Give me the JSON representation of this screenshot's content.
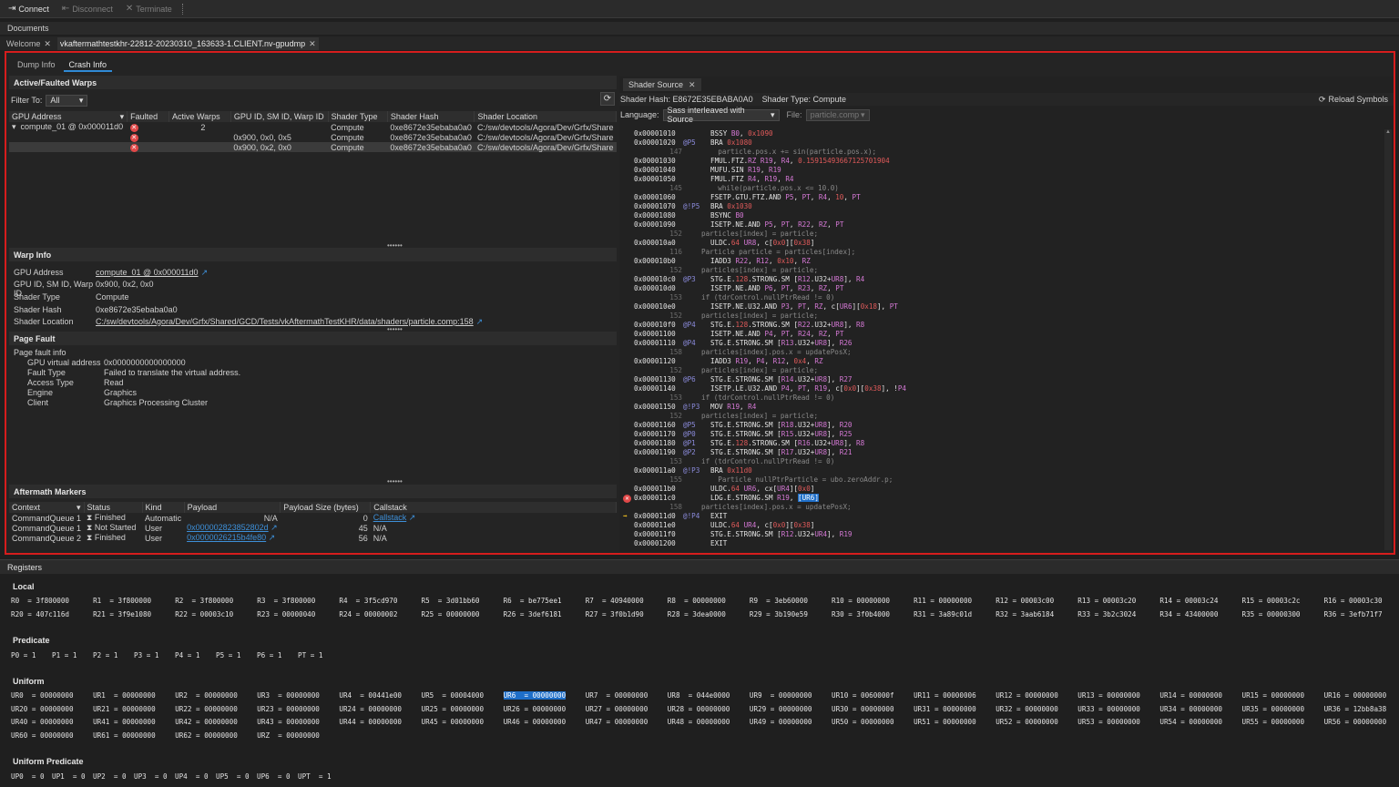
{
  "toolbar": {
    "connect": "Connect",
    "disconnect": "Disconnect",
    "terminate": "Terminate"
  },
  "documents_label": "Documents",
  "doc_tabs": [
    {
      "label": "Welcome"
    },
    {
      "label": "vkaftermathtestkhr-22812-20230310_163633-1.CLIENT.nv-gpudmp"
    }
  ],
  "sub_tabs": [
    "Dump Info",
    "Crash Info"
  ],
  "warps": {
    "title": "Active/Faulted Warps",
    "filter_label": "Filter To:",
    "filter_value": "All",
    "columns": [
      "GPU Address",
      "Faulted",
      "Active Warps",
      "GPU ID, SM ID, Warp ID",
      "Shader Type",
      "Shader Hash",
      "Shader Location"
    ],
    "rows": [
      {
        "addr": "compute_01 @ 0x000011d0",
        "faulted": true,
        "active": "2",
        "ids": "",
        "type": "Compute",
        "hash": "0xe8672e35ebaba0a0",
        "loc": "C:/sw/devtools/Agora/Dev/Grfx/Share"
      },
      {
        "addr": "",
        "faulted": true,
        "active": "",
        "ids": "0x900, 0x0, 0x5",
        "type": "Compute",
        "hash": "0xe8672e35ebaba0a0",
        "loc": "C:/sw/devtools/Agora/Dev/Grfx/Share"
      },
      {
        "addr": "",
        "faulted": true,
        "active": "",
        "ids": "0x900, 0x2, 0x0",
        "type": "Compute",
        "hash": "0xe8672e35ebaba0a0",
        "loc": "C:/sw/devtools/Agora/Dev/Grfx/Share"
      }
    ]
  },
  "warp_info": {
    "title": "Warp Info",
    "rows": [
      {
        "k": "GPU Address",
        "v": "compute_01 @ 0x000011d0"
      },
      {
        "k": "GPU ID, SM ID, Warp ID",
        "v": "0x900, 0x2, 0x0"
      },
      {
        "k": "Shader Type",
        "v": "Compute"
      },
      {
        "k": "Shader Hash",
        "v": "0xe8672e35ebaba0a0"
      },
      {
        "k": "Shader Location",
        "v": "C:/sw/devtools/Agora/Dev/Grfx/Shared/GCD/Tests/vkAftermathTestKHR/data/shaders/particle.comp:158"
      }
    ]
  },
  "page_fault": {
    "title": "Page Fault",
    "info_label": "Page fault info",
    "rows": [
      {
        "k": "GPU virtual address",
        "v": "0x0000000000000000"
      },
      {
        "k": "Fault Type",
        "v": "Failed to translate the virtual address."
      },
      {
        "k": "Access Type",
        "v": "Read"
      },
      {
        "k": "Engine",
        "v": "Graphics"
      },
      {
        "k": "Client",
        "v": "Graphics Processing Cluster"
      }
    ]
  },
  "markers": {
    "title": "Aftermath Markers",
    "columns": [
      "Context",
      "Status",
      "Kind",
      "Payload",
      "Payload Size (bytes)",
      "Callstack"
    ],
    "rows": [
      {
        "ctx": "CommandQueue 1",
        "status": "Finished",
        "kind": "Automatic",
        "payload": "N/A",
        "size": "0",
        "callstack": "Callstack"
      },
      {
        "ctx": "CommandQueue 1",
        "status": "Not Started",
        "kind": "User",
        "payload": "0x000002823852802d",
        "size": "45",
        "callstack": "N/A"
      },
      {
        "ctx": "CommandQueue 2",
        "status": "Finished",
        "kind": "User",
        "payload": "0x0000026215b4fe80",
        "size": "56",
        "callstack": "N/A"
      }
    ]
  },
  "shader": {
    "tab": "Shader Source",
    "hash": "Shader Hash: E8672E35EBABA0A0",
    "type": "Shader Type: Compute",
    "reload": "Reload Symbols",
    "language_label": "Language:",
    "language_value": "Sass interleaved with Source",
    "file_label": "File:",
    "file_value": "particle.comp",
    "lines": [
      {
        "a": "0x00001010",
        "p": "",
        "i": "BSSY B0, 0x1090"
      },
      {
        "a": "0x00001020",
        "p": "@P5",
        "i": "BRA 0x1080"
      },
      {
        "n": "147",
        "s": "    particle.pos.x += sin(particle.pos.x);"
      },
      {
        "a": "0x00001030",
        "p": "",
        "i": "FMUL.FTZ.RZ R19, R4, 0.15915493667125701904"
      },
      {
        "a": "0x00001040",
        "p": "",
        "i": "MUFU.SIN R19, R19"
      },
      {
        "a": "0x00001050",
        "p": "",
        "i": "FMUL.FTZ R4, R19, R4"
      },
      {
        "n": "145",
        "s": "    while(particle.pos.x <= 10.0)"
      },
      {
        "a": "0x00001060",
        "p": "",
        "i": "FSETP.GTU.FTZ.AND P5, PT, R4, 10, PT"
      },
      {
        "a": "0x00001070",
        "p": "@!P5",
        "i": "BRA 0x1030"
      },
      {
        "a": "0x00001080",
        "p": "",
        "i": "BSYNC B0"
      },
      {
        "a": "0x00001090",
        "p": "",
        "i": "ISETP.NE.AND P5, PT, R22, RZ, PT"
      },
      {
        "n": "152",
        "s": "particles[index] = particle;"
      },
      {
        "a": "0x000010a0",
        "p": "",
        "i": "ULDC.64 UR8, c[0x0][0x38]"
      },
      {
        "n": "116",
        "s": "Particle particle = particles[index];"
      },
      {
        "a": "0x000010b0",
        "p": "",
        "i": "IADD3 R22, R12, 0x10, RZ"
      },
      {
        "n": "152",
        "s": "particles[index] = particle;"
      },
      {
        "a": "0x000010c0",
        "p": "@P3",
        "i": "STG.E.128.STRONG.SM [R12.U32+UR8], R4"
      },
      {
        "a": "0x000010d0",
        "p": "",
        "i": "ISETP.NE.AND P6, PT, R23, RZ, PT"
      },
      {
        "n": "153",
        "s": "if (tdrControl.nullPtrRead != 0)"
      },
      {
        "a": "0x000010e0",
        "p": "",
        "i": "ISETP.NE.U32.AND P3, PT, RZ, c[UR6][0x18], PT"
      },
      {
        "n": "152",
        "s": "particles[index] = particle;"
      },
      {
        "a": "0x000010f0",
        "p": "@P4",
        "i": "STG.E.128.STRONG.SM [R22.U32+UR8], R8"
      },
      {
        "a": "0x00001100",
        "p": "",
        "i": "ISETP.NE.AND P4, PT, R24, RZ, PT"
      },
      {
        "a": "0x00001110",
        "p": "@P4",
        "i": "STG.E.STRONG.SM [R13.U32+UR8], R26"
      },
      {
        "n": "158",
        "s": "particles[index].pos.x = updatePosX;"
      },
      {
        "a": "0x00001120",
        "p": "",
        "i": "IADD3 R19, P4, R12, 0x4, RZ"
      },
      {
        "n": "152",
        "s": "particles[index] = particle;"
      },
      {
        "a": "0x00001130",
        "p": "@P6",
        "i": "STG.E.STRONG.SM [R14.U32+UR8], R27"
      },
      {
        "a": "0x00001140",
        "p": "",
        "i": "ISETP.LE.U32.AND P4, PT, R19, c[0x0][0x38], !P4"
      },
      {
        "n": "153",
        "s": "if (tdrControl.nullPtrRead != 0)"
      },
      {
        "a": "0x00001150",
        "p": "@!P3",
        "i": "MOV R19, R4"
      },
      {
        "n": "152",
        "s": "particles[index] = particle;"
      },
      {
        "a": "0x00001160",
        "p": "@P5",
        "i": "STG.E.STRONG.SM [R18.U32+UR8], R20"
      },
      {
        "a": "0x00001170",
        "p": "@P0",
        "i": "STG.E.STRONG.SM [R15.U32+UR8], R25"
      },
      {
        "a": "0x00001180",
        "p": "@P1",
        "i": "STG.E.128.STRONG.SM [R16.U32+UR8], R8"
      },
      {
        "a": "0x00001190",
        "p": "@P2",
        "i": "STG.E.STRONG.SM [R17.U32+UR8], R21"
      },
      {
        "n": "153",
        "s": "if (tdrControl.nullPtrRead != 0)"
      },
      {
        "a": "0x000011a0",
        "p": "@!P3",
        "i": "BRA 0x11d0"
      },
      {
        "n": "155",
        "s": "    Particle nullPtrParticle = ubo.zeroAddr.p;"
      },
      {
        "a": "0x000011b0",
        "p": "",
        "i": "ULDC.64 UR6, cx[UR4][0x0]"
      },
      {
        "a": "0x000011c0",
        "p": "",
        "i": "LDG.E.STRONG.SM R19, [UR6]",
        "m": "fault"
      },
      {
        "n": "158",
        "s": "particles[index].pos.x = updatePosX;"
      },
      {
        "a": "0x000011d0",
        "p": "@!P4",
        "i": "EXIT",
        "m": "arrow"
      },
      {
        "a": "0x000011e0",
        "p": "",
        "i": "ULDC.64 UR4, c[0x0][0x38]"
      },
      {
        "a": "0x000011f0",
        "p": "",
        "i": "STG.E.STRONG.SM [R12.U32+UR4], R19"
      },
      {
        "a": "0x00001200",
        "p": "",
        "i": "EXIT"
      }
    ]
  },
  "registers": {
    "title": "Registers",
    "local_title": "Local",
    "local": [
      [
        "R0",
        "3f800000"
      ],
      [
        "R1",
        "3f800000"
      ],
      [
        "R2",
        "3f800000"
      ],
      [
        "R3",
        "3f800000"
      ],
      [
        "R4",
        "3f5cd970"
      ],
      [
        "R5",
        "3d01bb60"
      ],
      [
        "R6",
        "be775ee1"
      ],
      [
        "R7",
        "40940000"
      ],
      [
        "R8",
        "00000000"
      ],
      [
        "R9",
        "3eb60000"
      ],
      [
        "R10",
        "00000000"
      ],
      [
        "R11",
        "00000000"
      ],
      [
        "R12",
        "00003c00"
      ],
      [
        "R13",
        "00003c20"
      ],
      [
        "R14",
        "00003c24"
      ],
      [
        "R15",
        "00003c2c"
      ],
      [
        "R16",
        "00003c30"
      ],
      [
        "R20",
        "407c116d"
      ],
      [
        "R21",
        "3f9e1080"
      ],
      [
        "R22",
        "00003c10"
      ],
      [
        "R23",
        "00000040"
      ],
      [
        "R24",
        "00000002"
      ],
      [
        "R25",
        "00000000"
      ],
      [
        "R26",
        "3def6181"
      ],
      [
        "R27",
        "3f0b1d90"
      ],
      [
        "R28",
        "3dea0000"
      ],
      [
        "R29",
        "3b190e59"
      ],
      [
        "R30",
        "3f0b4000"
      ],
      [
        "R31",
        "3a89c01d"
      ],
      [
        "R32",
        "3aab6184"
      ],
      [
        "R33",
        "3b2c3024"
      ],
      [
        "R34",
        "43400000"
      ],
      [
        "R35",
        "00000300"
      ],
      [
        "R36",
        "3efb71f7"
      ]
    ],
    "predicate_title": "Predicate",
    "predicate": [
      [
        "P0",
        "1"
      ],
      [
        "P1",
        "1"
      ],
      [
        "P2",
        "1"
      ],
      [
        "P3",
        "1"
      ],
      [
        "P4",
        "1"
      ],
      [
        "P5",
        "1"
      ],
      [
        "P6",
        "1"
      ],
      [
        "PT",
        "1"
      ]
    ],
    "uniform_title": "Uniform",
    "uniform": [
      [
        "UR0",
        "00000000"
      ],
      [
        "UR1",
        "00000000"
      ],
      [
        "UR2",
        "00000000"
      ],
      [
        "UR3",
        "00000000"
      ],
      [
        "UR4",
        "00441e00"
      ],
      [
        "UR5",
        "00004000"
      ],
      [
        "UR6",
        "00000000"
      ],
      [
        "UR7",
        "00000000"
      ],
      [
        "UR8",
        "044e0000"
      ],
      [
        "UR9",
        "00000000"
      ],
      [
        "UR10",
        "0060000f"
      ],
      [
        "UR11",
        "00000006"
      ],
      [
        "UR12",
        "00000000"
      ],
      [
        "UR13",
        "00000000"
      ],
      [
        "UR14",
        "00000000"
      ],
      [
        "UR15",
        "00000000"
      ],
      [
        "UR16",
        "00000000"
      ],
      [
        "UR20",
        "00000000"
      ],
      [
        "UR21",
        "00000000"
      ],
      [
        "UR22",
        "00000000"
      ],
      [
        "UR23",
        "00000000"
      ],
      [
        "UR24",
        "00000000"
      ],
      [
        "UR25",
        "00000000"
      ],
      [
        "UR26",
        "00000000"
      ],
      [
        "UR27",
        "00000000"
      ],
      [
        "UR28",
        "00000000"
      ],
      [
        "UR29",
        "00000000"
      ],
      [
        "UR30",
        "00000000"
      ],
      [
        "UR31",
        "00000000"
      ],
      [
        "UR32",
        "00000000"
      ],
      [
        "UR33",
        "00000000"
      ],
      [
        "UR34",
        "00000000"
      ],
      [
        "UR35",
        "00000000"
      ],
      [
        "UR36",
        "12bb8a38"
      ],
      [
        "UR40",
        "00000000"
      ],
      [
        "UR41",
        "00000000"
      ],
      [
        "UR42",
        "00000000"
      ],
      [
        "UR43",
        "00000000"
      ],
      [
        "UR44",
        "00000000"
      ],
      [
        "UR45",
        "00000000"
      ],
      [
        "UR46",
        "00000000"
      ],
      [
        "UR47",
        "00000000"
      ],
      [
        "UR48",
        "00000000"
      ],
      [
        "UR49",
        "00000000"
      ],
      [
        "UR50",
        "00000000"
      ],
      [
        "UR51",
        "00000000"
      ],
      [
        "UR52",
        "00000000"
      ],
      [
        "UR53",
        "00000000"
      ],
      [
        "UR54",
        "00000000"
      ],
      [
        "UR55",
        "00000000"
      ],
      [
        "UR56",
        "00000000"
      ],
      [
        "UR60",
        "00000000"
      ],
      [
        "UR61",
        "00000000"
      ],
      [
        "UR62",
        "00000000"
      ],
      [
        "URZ",
        "00000000"
      ]
    ],
    "uniform_pred_title": "Uniform Predicate",
    "uniform_pred": [
      [
        "UP0",
        "0"
      ],
      [
        "UP1",
        "0"
      ],
      [
        "UP2",
        "0"
      ],
      [
        "UP3",
        "0"
      ],
      [
        "UP4",
        "0"
      ],
      [
        "UP5",
        "0"
      ],
      [
        "UP6",
        "0"
      ],
      [
        "UPT",
        "1"
      ]
    ],
    "highlighted": "UR6"
  }
}
